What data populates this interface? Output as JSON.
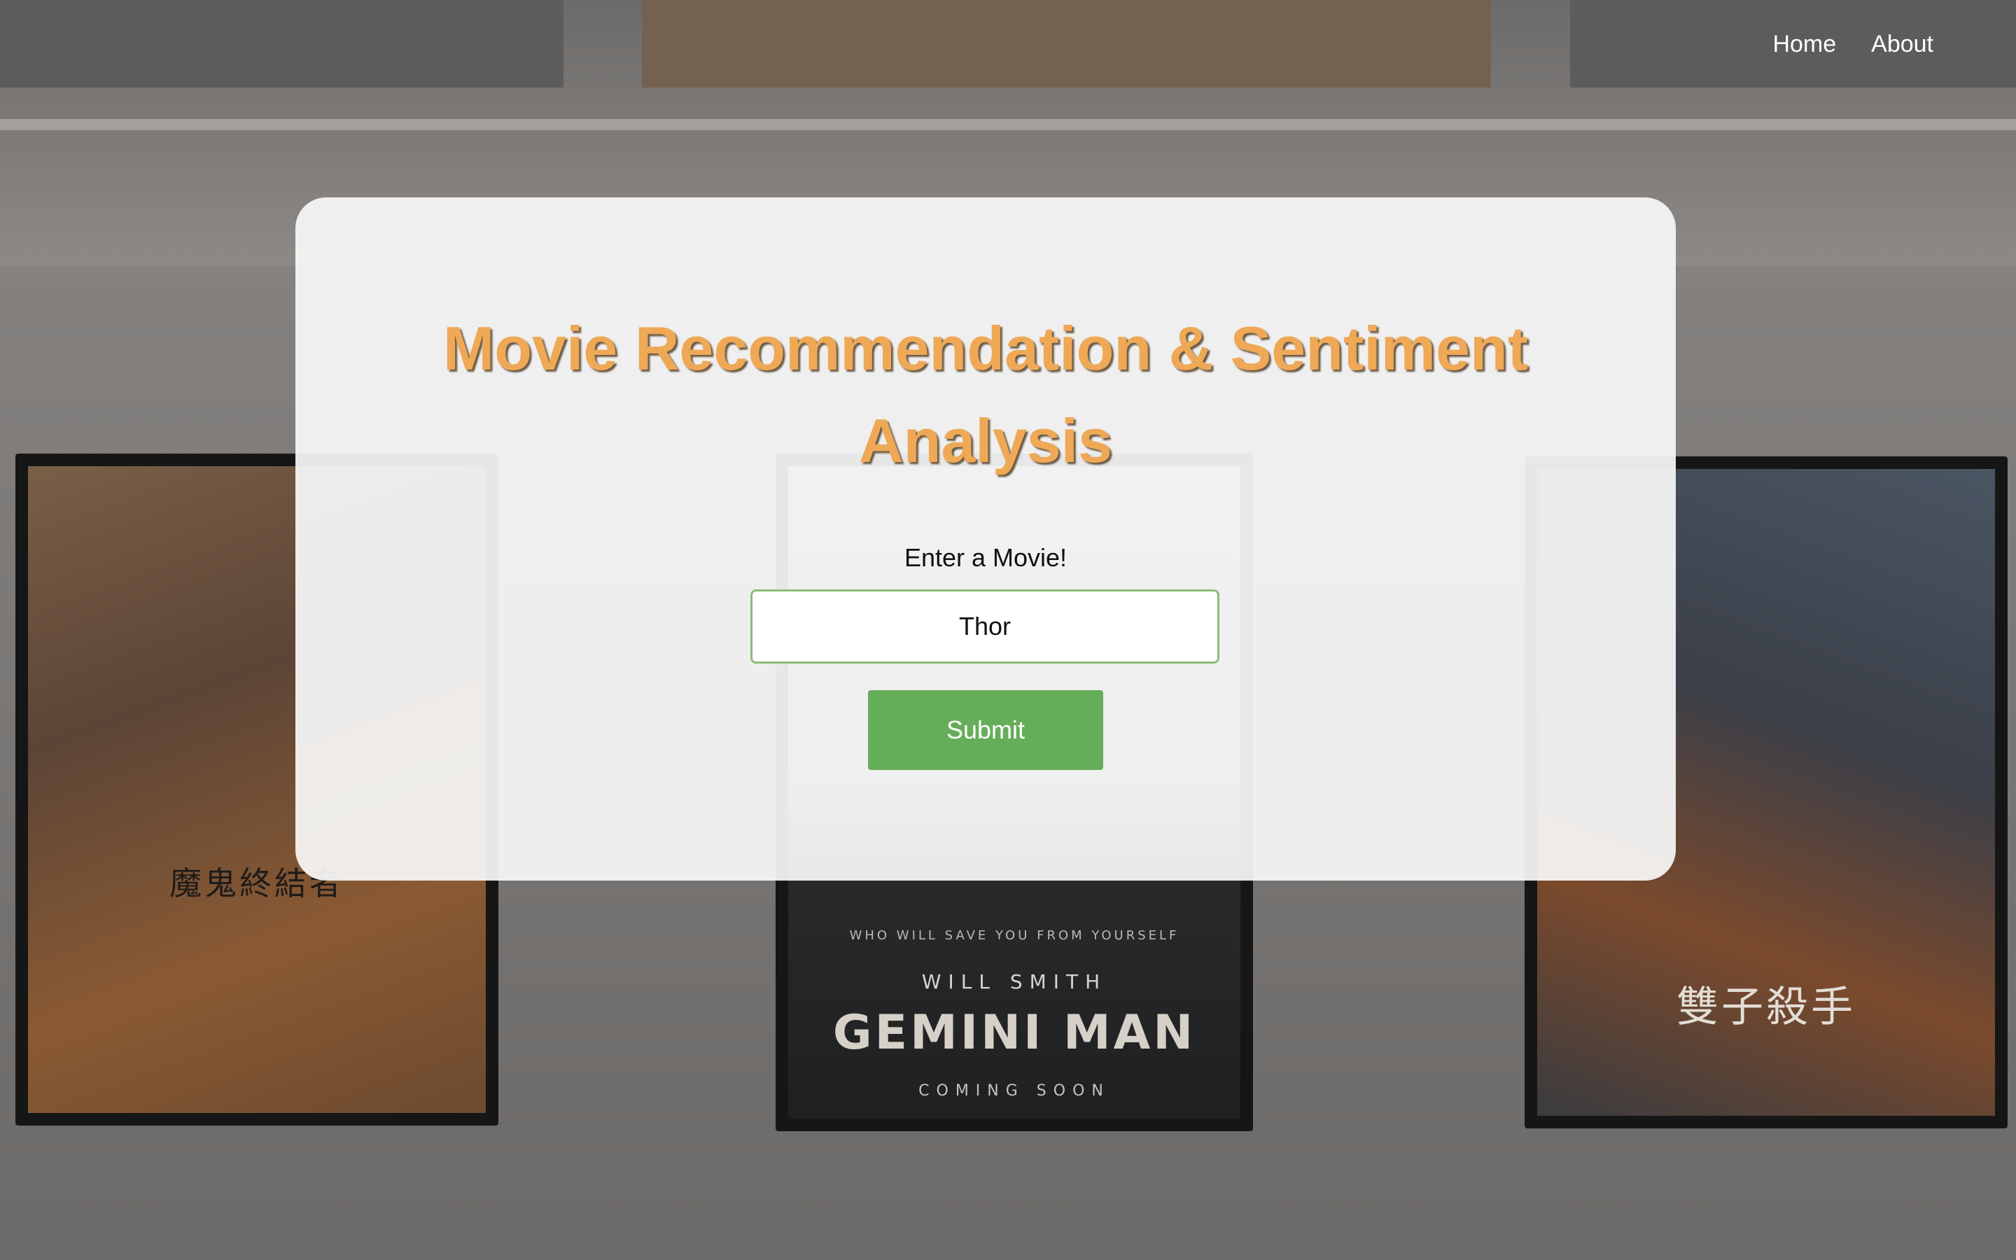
{
  "nav": {
    "home_label": "Home",
    "about_label": "About"
  },
  "card": {
    "title": "Movie Recommendation & Sentiment Analysis",
    "input_label": "Enter a Movie!",
    "input_value": "Thor",
    "submit_label": "Submit"
  },
  "background": {
    "poster_center": {
      "tagline": "WHO WILL SAVE YOU FROM YOURSELF",
      "actor": "WILL SMITH",
      "title": "GEMINI MAN",
      "bottom": "COMING SOON"
    },
    "poster_left": {
      "title": "魔鬼終結者"
    },
    "poster_right": {
      "title": "雙子殺手"
    }
  },
  "colors": {
    "title": "#efa855",
    "button": "#66ad5a",
    "input_border": "#8bbd78",
    "card": "#f8f8f8"
  }
}
